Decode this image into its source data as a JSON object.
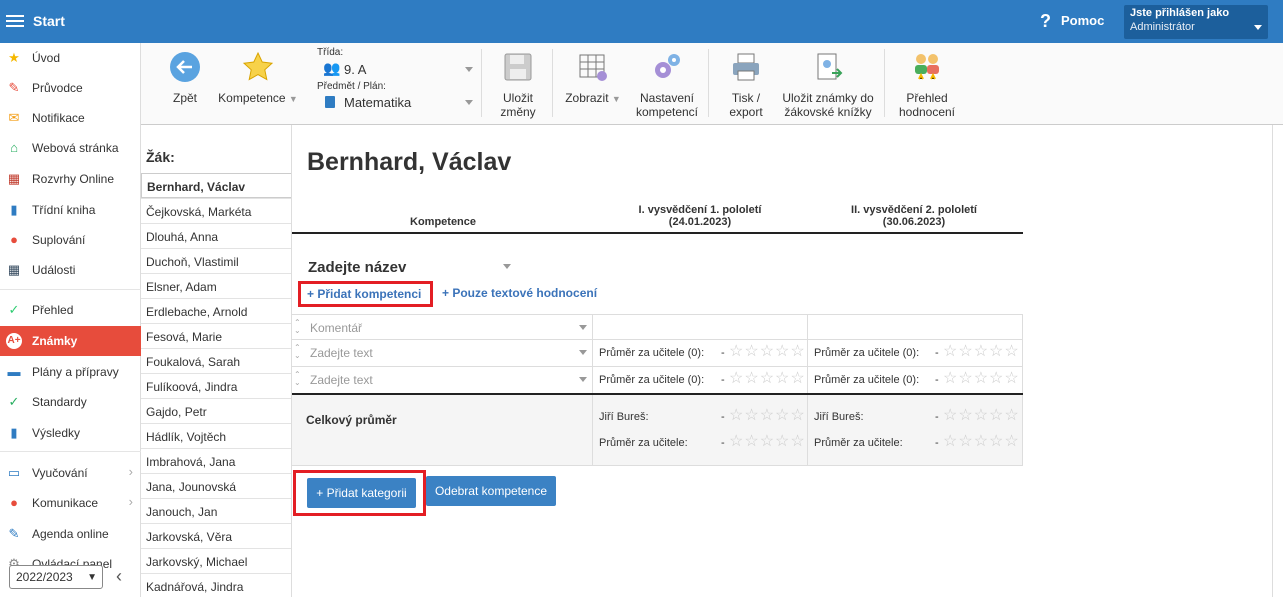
{
  "topbar": {
    "title": "Start",
    "help": "Pomoc",
    "help_icon": "?",
    "user_line1": "Jste přihlášen jako",
    "user_line2": "Administrátor"
  },
  "sidebar": {
    "items": [
      {
        "label": "Úvod",
        "icon": "star-icon",
        "color": "#f5b800",
        "glyph": "★"
      },
      {
        "label": "Průvodce",
        "icon": "wand-icon",
        "color": "#e74c3c",
        "glyph": "✎"
      },
      {
        "label": "Notifikace",
        "icon": "envelope-icon",
        "color": "#f39c12",
        "glyph": "✉"
      },
      {
        "label": "Webová stránka",
        "icon": "home-icon",
        "color": "#27ae60",
        "glyph": "⌂"
      },
      {
        "label": "Rozvrhy Online",
        "icon": "grid-icon",
        "color": "#c0392b",
        "glyph": "▦"
      },
      {
        "label": "Třídní kniha",
        "icon": "book-icon",
        "color": "#2f7cc2",
        "glyph": "▮"
      },
      {
        "label": "Suplování",
        "icon": "person-icon",
        "color": "#e74c3c",
        "glyph": "●"
      },
      {
        "label": "Události",
        "icon": "calendar-icon",
        "color": "#34495e",
        "glyph": "▦"
      },
      {
        "label": "Přehled",
        "icon": "check-icon",
        "color": "#2ecc71",
        "glyph": "✓"
      },
      {
        "label": "Známky",
        "icon": "grade-icon",
        "color": "#e74c3c",
        "glyph": "A+"
      },
      {
        "label": "Plány a přípravy",
        "icon": "briefcase-icon",
        "color": "#2f7cc2",
        "glyph": "▬"
      },
      {
        "label": "Standardy",
        "icon": "shield-icon",
        "color": "#27ae60",
        "glyph": "✓"
      },
      {
        "label": "Výsledky",
        "icon": "bar-chart-icon",
        "color": "#2f7cc2",
        "glyph": "▮"
      },
      {
        "label": "Vyučování",
        "icon": "board-icon",
        "color": "#2f7cc2",
        "glyph": "▭"
      },
      {
        "label": "Komunikace",
        "icon": "chat-icon",
        "color": "#e74c3c",
        "glyph": "●"
      },
      {
        "label": "Agenda online",
        "icon": "pen-icon",
        "color": "#2f7cc2",
        "glyph": "✎"
      },
      {
        "label": "Ovládací panel",
        "icon": "gear-icon",
        "color": "#888888",
        "glyph": "⚙"
      }
    ],
    "year": "2022/2023",
    "collapse": "‹"
  },
  "toolbar": {
    "back": "Zpět",
    "competence": "Kompetence",
    "class_label": "Třída:",
    "class_value": "9. A",
    "subject_label": "Předmět / Plán:",
    "subject_value": "Matematika",
    "save1": "Uložit",
    "save2": "změny",
    "show": "Zobrazit",
    "settings1": "Nastavení",
    "settings2": "kompetencí",
    "print1": "Tisk /",
    "print2": "export",
    "book1": "Uložit známky do",
    "book2": "žákovské knížky",
    "overview1": "Přehled",
    "overview2": "hodnocení"
  },
  "students": {
    "heading": "Žák:",
    "list": [
      "Bernhard, Václav",
      "Čejkovská, Markéta",
      "Dlouhá, Anna",
      "Duchoň, Vlastimil",
      "Elsner, Adam",
      "Erdlebache, Arnold",
      "Fesová, Marie",
      "Foukalová, Sarah",
      "Fulíkoová, Jindra",
      "Gajdo, Petr",
      "Hádlík, Vojtěch",
      "Imbrahová, Jana",
      "Jana, Jounovská",
      "Janouch, Jan",
      "Jarkovská, Věra",
      "Jarkovský, Michael",
      "Kadnářová, Jindra"
    ]
  },
  "main": {
    "name": "Bernhard, Václav",
    "col_comp": "Kompetence",
    "p1a": "I. vysvědčení 1. pololetí",
    "p1b": "(24.01.2023)",
    "p2a": "II. vysvědčení 2. pololetí",
    "p2b": "(30.06.2023)",
    "category": "Zadejte název",
    "add_comp": "+ Přidat kompetenci",
    "text_only": "+ Pouze textové hodnocení",
    "comment_ph": "Komentář",
    "text_ph": "Zadejte text",
    "avg_teacher0": "Průměr za učitele (0):",
    "dash": "-",
    "stars": "☆☆☆☆☆",
    "total": "Celkový průměr",
    "teacher": "Jiří Bureš:",
    "avg_teacher": "Průměr za učitele:",
    "add_cat": "+ Přidat kategorii",
    "del_comp": "Odebrat kompetence"
  }
}
